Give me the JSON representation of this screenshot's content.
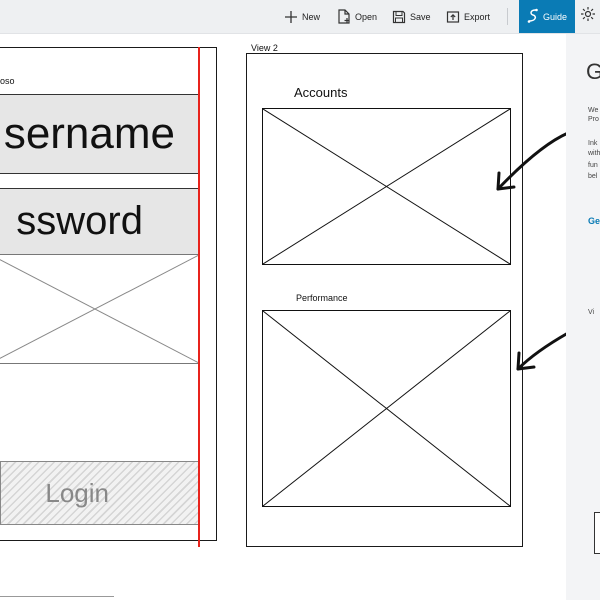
{
  "toolbar": {
    "new_label": "New",
    "open_label": "Open",
    "save_label": "Save",
    "export_label": "Export",
    "guide_label": "Guide",
    "accent_color": "#0a7bb5"
  },
  "guide_panel": {
    "title": "G",
    "text_lines": [
      "We",
      "Pro",
      "",
      "Ink",
      "with",
      "fun",
      "bel"
    ],
    "link": "Ge",
    "view_label": "Vi"
  },
  "view1": {
    "label": "oso",
    "username": "sername",
    "password": "ssword",
    "login": "Login"
  },
  "view2": {
    "label": "View 2",
    "accounts": "Accounts",
    "performance": "Performance"
  },
  "colors": {
    "red_line": "#e8231c",
    "field_bg": "#e6e6e6"
  },
  "icons": [
    "plus-icon",
    "new-file-icon",
    "save-disk-icon",
    "export-icon",
    "guide-icon",
    "gear-icon"
  ]
}
